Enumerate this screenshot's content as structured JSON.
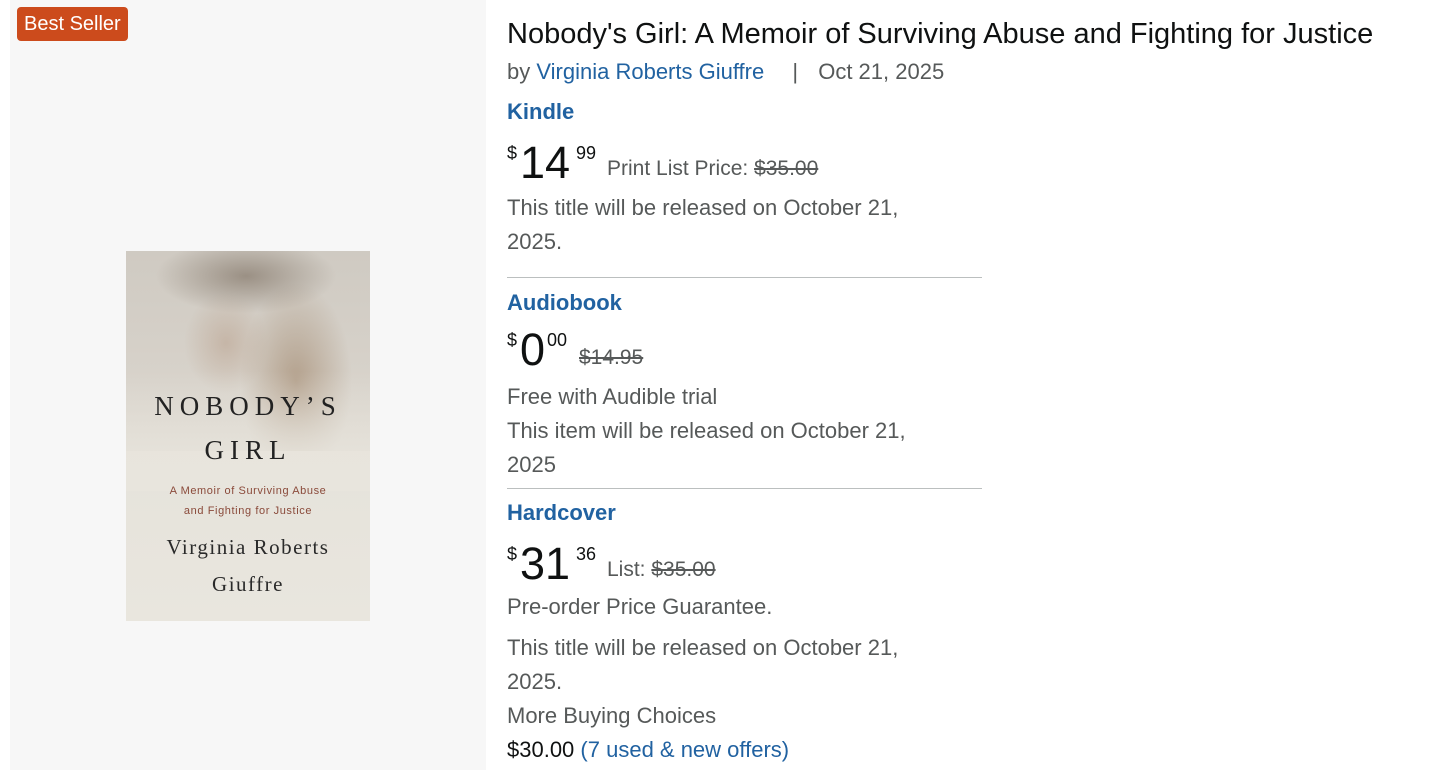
{
  "badge": "Best Seller",
  "cover": {
    "title_line1": "NOBODY’S",
    "title_line2": "GIRL",
    "subtitle_line1": "A Memoir of Surviving Abuse",
    "subtitle_line2": "and Fighting for Justice",
    "author_line1": "Virginia Roberts",
    "author_line2": "Giuffre"
  },
  "product": {
    "title": "Nobody's Girl: A Memoir of Surviving Abuse and Fighting for Justice",
    "by_label": "by",
    "author": "Virginia Roberts Giuffre",
    "separator": "|",
    "date": "Oct 21, 2025"
  },
  "formats": {
    "kindle": {
      "name": "Kindle",
      "currency": "$",
      "price_whole": "14",
      "price_fraction": "99",
      "list_label": "Print List Price:",
      "list_price": "$35.00",
      "release_line1": "This title will be released on October 21,",
      "release_line2": "2025."
    },
    "audiobook": {
      "name": "Audiobook",
      "currency": "$",
      "price_whole": "0",
      "price_fraction": "00",
      "list_price": "$14.95",
      "trial_text": "Free with Audible trial",
      "release_line1": "This item will be released on October 21,",
      "release_line2": "2025"
    },
    "hardcover": {
      "name": "Hardcover",
      "currency": "$",
      "price_whole": "31",
      "price_fraction": "36",
      "list_label": "List:",
      "list_price": "$35.00",
      "guarantee": "Pre-order Price Guarantee.",
      "release_line1": "This title will be released on October 21,",
      "release_line2": "2025.",
      "more_choices_label": "More Buying Choices",
      "more_choices_price": "$30.00",
      "offers_link": "(7 used & new offers)"
    }
  },
  "colors": {
    "badge_bg": "#cc4b1c",
    "link": "#2162a1",
    "muted_text": "#565959",
    "divider": "#bbbfbf",
    "image_panel_bg": "#f7f7f7"
  }
}
